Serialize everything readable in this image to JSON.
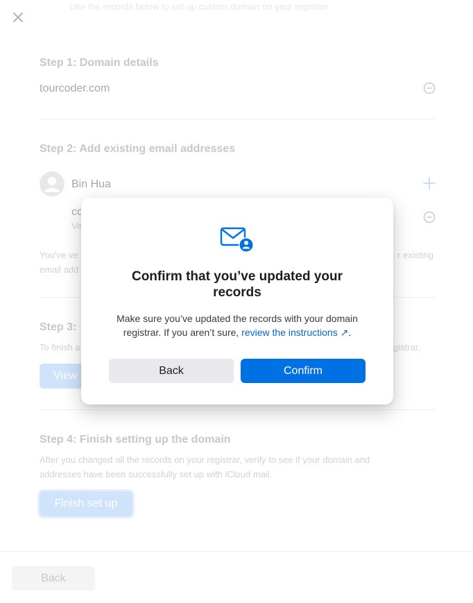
{
  "background": {
    "top_clipped_text": "Use the records below to set up custom domain on your registrar",
    "step1": {
      "title": "Step 1: Domain details",
      "domain": "tourcoder.com"
    },
    "step2": {
      "title": "Step 2: Add existing email addresses",
      "person_name": "Bin Hua",
      "address_line": "co",
      "address_status": "Ve",
      "note_line1_start": "You've ve",
      "note_line1_end": "r existing",
      "note_line2": "email add"
    },
    "step3": {
      "title": "Step 3:",
      "desc_start": "To finish a",
      "desc_end": "gistrar.",
      "button_label": "View"
    },
    "step4": {
      "title": "Step 4: Finish setting up the domain",
      "desc_line1": "After you changed all the records on your registrar, verify to see if your domain and",
      "desc_line2": "addresses have been successfully set up with iCloud mail.",
      "button_label": "Finish set up"
    },
    "footer_back_label": "Back"
  },
  "modal": {
    "icon": "mail-person-icon",
    "title": "Confirm that you’ve updated your records",
    "body_prefix": "Make sure you’ve updated the records with your domain registrar. If you aren’t sure, ",
    "link_text": "review the instructions ↗",
    "body_suffix": ".",
    "back_label": "Back",
    "confirm_label": "Confirm"
  },
  "colors": {
    "accent": "#0071e3",
    "link": "#0066cc",
    "disabled_blue": "#cfe4fb"
  }
}
